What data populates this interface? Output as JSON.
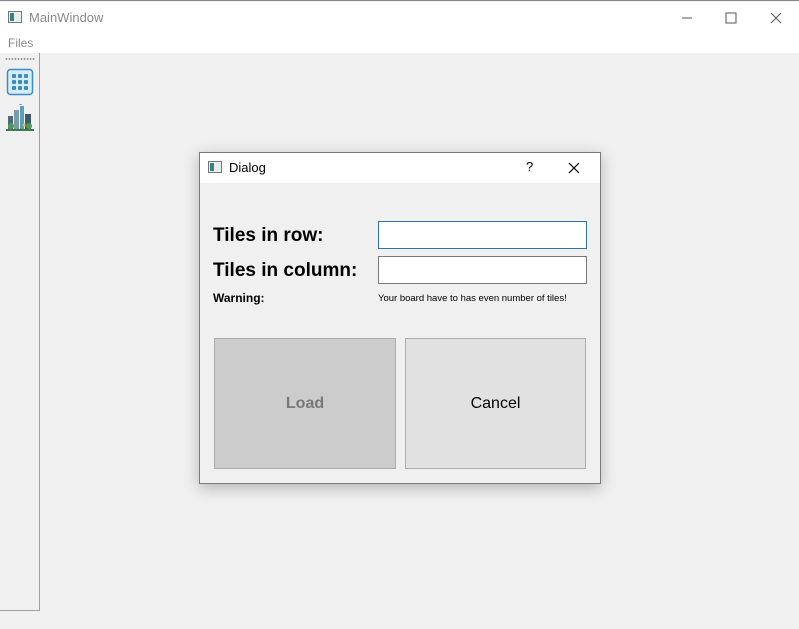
{
  "window": {
    "title": "MainWindow"
  },
  "menu": {
    "files_label": "Files"
  },
  "toolbar": {
    "items": [
      "grid-icon",
      "city-icon"
    ]
  },
  "dialog": {
    "title": "Dialog",
    "help": "?",
    "row_label": "Tiles in row:",
    "row_value": "",
    "column_label": "Tiles in column:",
    "column_value": "",
    "warning_label": "Warning:",
    "warning_text": "Your board have to has even number of tiles!",
    "load_label": "Load",
    "cancel_label": "Cancel"
  },
  "colors": {
    "focus_border": "#2b74a8",
    "load_bg": "#cccccc",
    "cancel_bg": "#e1e1e1"
  }
}
